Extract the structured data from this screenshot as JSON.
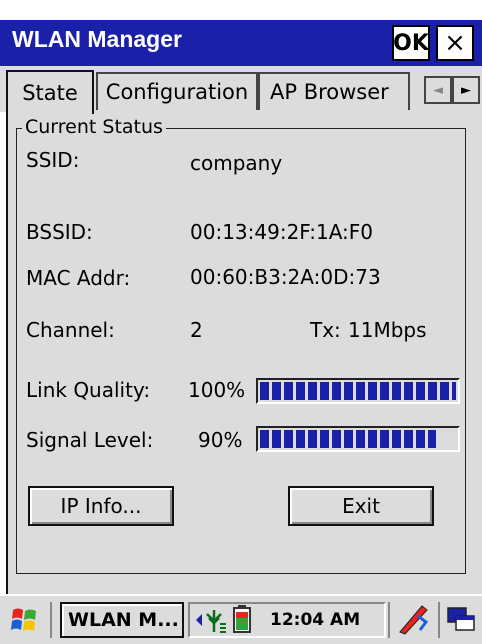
{
  "window": {
    "title": "WLAN Manager",
    "ok_label": "OK",
    "close_label": "×"
  },
  "tabs": [
    {
      "label": "State",
      "active": true
    },
    {
      "label": "Configuration",
      "active": false
    },
    {
      "label": "AP Browser",
      "active": false
    }
  ],
  "tab_scroll": {
    "left": "◄",
    "right": "►"
  },
  "status": {
    "group_title": "Current Status",
    "ssid_label": "SSID:",
    "ssid_value": "company",
    "bssid_label": "BSSID:",
    "bssid_value": "00:13:49:2F:1A:F0",
    "mac_label": "MAC Addr:",
    "mac_value": "00:60:B3:2A:0D:73",
    "channel_label": "Channel:",
    "channel_value": "2",
    "tx_label": "Tx:",
    "tx_value": "11Mbps",
    "link_label": "Link Quality:",
    "link_value": "100%",
    "link_level": 1.0,
    "signal_label": "Signal Level:",
    "signal_value": "90%",
    "signal_level": 0.9
  },
  "buttons": {
    "ip_info": "IP Info...",
    "exit": "Exit"
  },
  "taskbar": {
    "app_label": "WLAN M...",
    "clock": "12:04 AM",
    "icons": [
      "windows-start-icon",
      "wifi-signal-icon",
      "battery-icon",
      "pen-input-icon",
      "window-switch-icon"
    ]
  },
  "colors": {
    "title_bar": "#1a21a8",
    "progress": "#1a21a8",
    "face": "#dcdcdc"
  }
}
